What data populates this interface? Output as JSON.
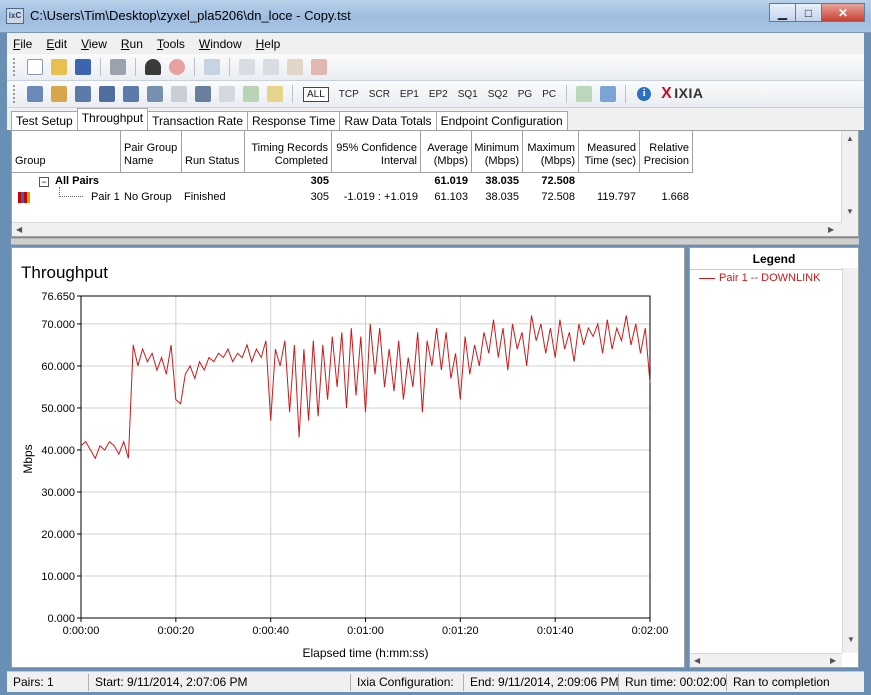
{
  "window": {
    "title": "C:\\Users\\Tim\\Desktop\\zyxel_pla5206\\dn_loce - Copy.tst",
    "icon_text": "ixC",
    "buttons": {
      "minimize": "▁",
      "maximize": "□",
      "close": "✕"
    }
  },
  "menu": [
    "File",
    "Edit",
    "View",
    "Run",
    "Tools",
    "Window",
    "Help"
  ],
  "toolbar2": {
    "protocols": [
      "ALL",
      "TCP",
      "SCR",
      "EP1",
      "EP2",
      "SQ1",
      "SQ2",
      "PG",
      "PC"
    ],
    "brand": "IXIA",
    "brand_mark": "X",
    "info_glyph": "i"
  },
  "tabs": [
    "Test Setup",
    "Throughput",
    "Transaction Rate",
    "Response Time",
    "Raw Data Totals",
    "Endpoint Configuration"
  ],
  "grid": {
    "headers": [
      "Group",
      "Pair Group Name",
      "Run Status",
      "Timing Records Completed",
      "95% Confidence Interval",
      "Average (Mbps)",
      "Minimum (Mbps)",
      "Maximum (Mbps)",
      "Measured Time (sec)",
      "Relative Precision"
    ],
    "rows": [
      {
        "group": "All Pairs",
        "expander": "−",
        "records": "305",
        "average": "61.019",
        "minimum": "38.035",
        "maximum": "72.508"
      },
      {
        "group": "Pair 1",
        "pair_group_name": "No Group",
        "run_status": "Finished",
        "records": "305",
        "confidence": "-1.019 : +1.019",
        "average": "61.103",
        "minimum": "38.035",
        "maximum": "72.508",
        "measured_time": "119.797",
        "relative_precision": "1.668"
      }
    ]
  },
  "legend": {
    "title": "Legend",
    "items": [
      "Pair 1 -- DOWNLINK"
    ]
  },
  "chart_data": {
    "type": "line",
    "title": "Throughput",
    "xlabel": "Elapsed time (h:mm:ss)",
    "ylabel": "Mbps",
    "xlim": [
      0,
      120
    ],
    "ylim": [
      0,
      76.65
    ],
    "grid": true,
    "legend_placement": "right-panel",
    "x_ticks": [
      0,
      20,
      40,
      60,
      80,
      100,
      120
    ],
    "x_tick_labels": [
      "0:00:00",
      "0:00:20",
      "0:00:40",
      "0:01:00",
      "0:01:20",
      "0:01:40",
      "0:02:00"
    ],
    "y_ticks": [
      0,
      10,
      20,
      30,
      40,
      50,
      60,
      70,
      76.65
    ],
    "y_tick_labels": [
      "0.000",
      "10.000",
      "20.000",
      "30.000",
      "40.000",
      "50.000",
      "60.000",
      "70.000",
      "76.650"
    ],
    "series": [
      {
        "name": "Pair 1 -- DOWNLINK",
        "color": "#cc1a1a",
        "x": [
          0,
          1,
          2,
          3,
          4,
          5,
          6,
          7,
          8,
          9,
          10,
          11,
          12,
          13,
          14,
          15,
          16,
          17,
          18,
          19,
          20,
          21,
          22,
          23,
          24,
          25,
          26,
          27,
          28,
          29,
          30,
          31,
          32,
          33,
          34,
          35,
          36,
          37,
          38,
          39,
          40,
          41,
          42,
          43,
          44,
          45,
          46,
          47,
          48,
          49,
          50,
          51,
          52,
          53,
          54,
          55,
          56,
          57,
          58,
          59,
          60,
          61,
          62,
          63,
          64,
          65,
          66,
          67,
          68,
          69,
          70,
          71,
          72,
          73,
          74,
          75,
          76,
          77,
          78,
          79,
          80,
          81,
          82,
          83,
          84,
          85,
          86,
          87,
          88,
          89,
          90,
          91,
          92,
          93,
          94,
          95,
          96,
          97,
          98,
          99,
          100,
          101,
          102,
          103,
          104,
          105,
          106,
          107,
          108,
          109,
          110,
          111,
          112,
          113,
          114,
          115,
          116,
          117,
          118,
          119,
          120
        ],
        "values": [
          41,
          42,
          40,
          38,
          41,
          40,
          42,
          41,
          39,
          42,
          38,
          65,
          60,
          64,
          61,
          63,
          59,
          62,
          58,
          65,
          52,
          51,
          58,
          60,
          57,
          61,
          59,
          62,
          61,
          63,
          62,
          64,
          61,
          63,
          62,
          65,
          61,
          64,
          62,
          66,
          47,
          64,
          60,
          66,
          49,
          65,
          43,
          64,
          47,
          66,
          48,
          65,
          52,
          67,
          55,
          68,
          50,
          69,
          53,
          67,
          49,
          70,
          58,
          69,
          55,
          64,
          54,
          66,
          52,
          62,
          55,
          68,
          49,
          66,
          60,
          69,
          59,
          68,
          57,
          63,
          52,
          67,
          58,
          65,
          60,
          68,
          63,
          71,
          62,
          69,
          59,
          70,
          64,
          68,
          60,
          72,
          66,
          70,
          63,
          69,
          62,
          71,
          64,
          68,
          61,
          70,
          65,
          69,
          67,
          70,
          63,
          71,
          64,
          69,
          66,
          72,
          65,
          70,
          63,
          69,
          56
        ]
      }
    ]
  },
  "status": {
    "pairs": "Pairs: 1",
    "start": "Start: 9/11/2014, 2:07:06 PM",
    "ixia_config": "Ixia Configuration:",
    "end": "End: 9/11/2014, 2:09:06 PM",
    "run_time": "Run time: 00:02:00",
    "completion": "Ran to completion"
  }
}
